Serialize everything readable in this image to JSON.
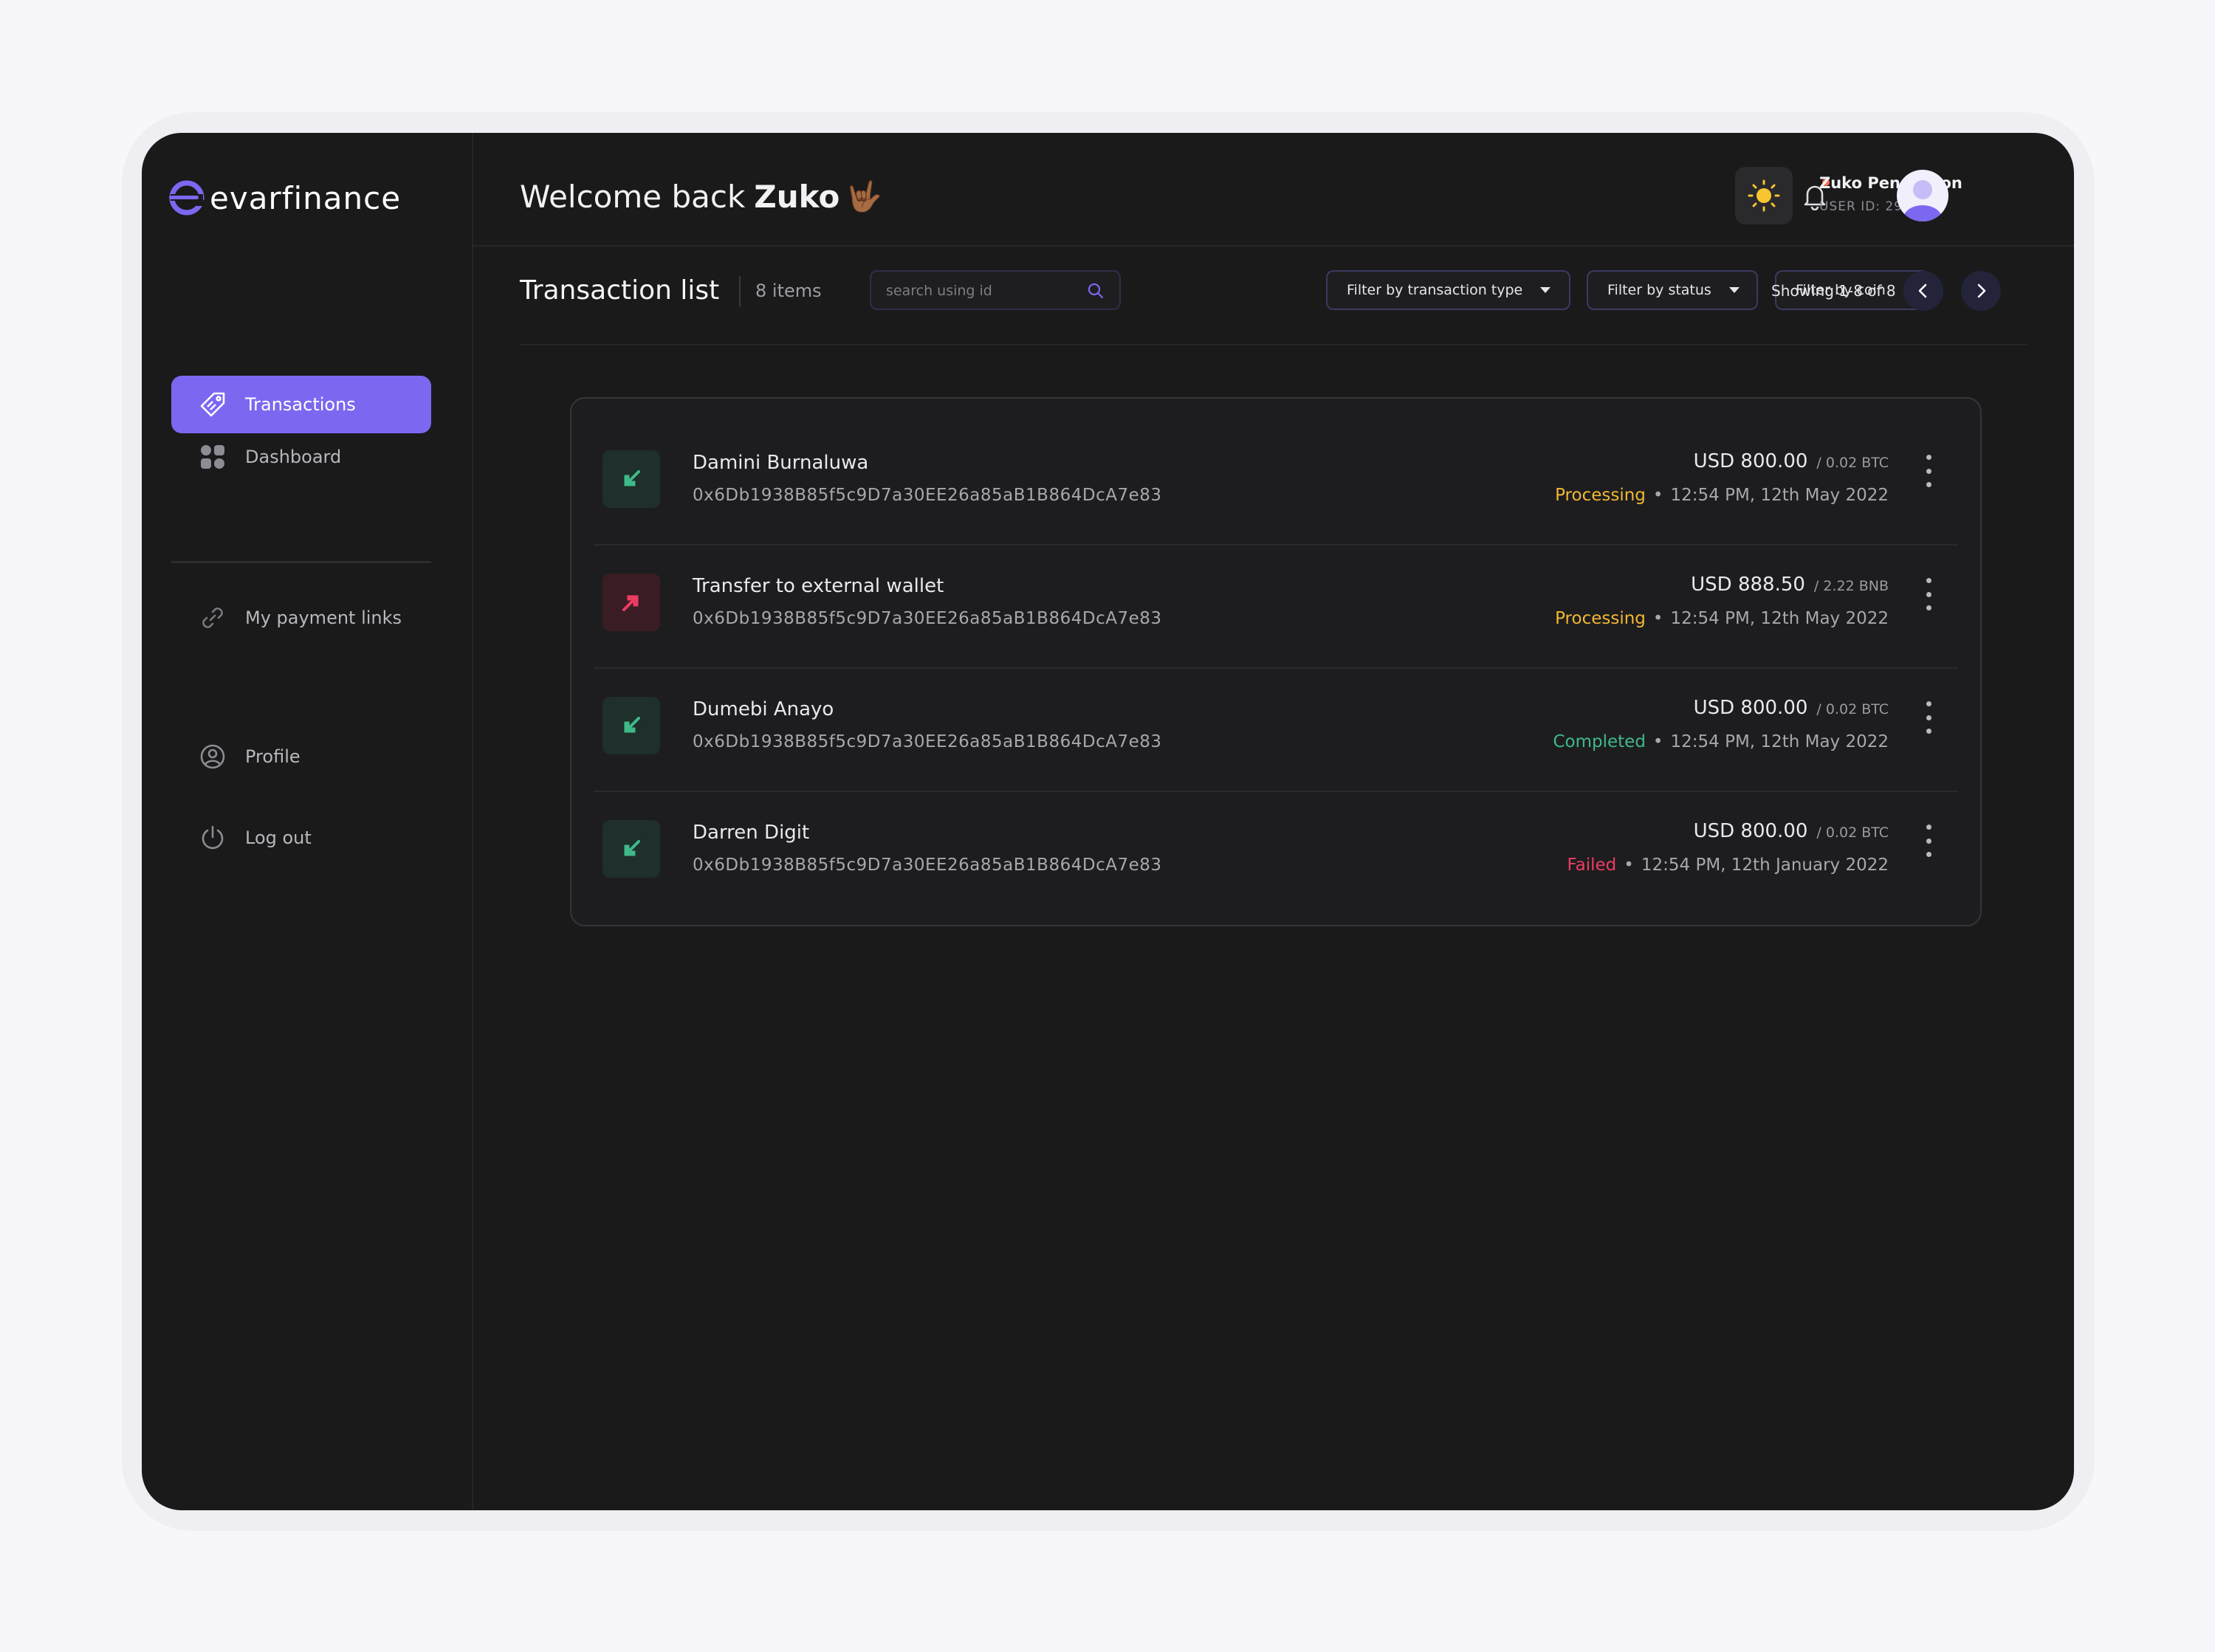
{
  "brand": {
    "name": "evarfinance",
    "accent_color": "#7b68f0"
  },
  "sidebar": {
    "items": [
      {
        "label": "Dashboard",
        "icon": "grid-icon"
      },
      {
        "label": "Transactions",
        "icon": "tag-icon",
        "active": true
      },
      {
        "label": "My payment links",
        "icon": "link-icon"
      },
      {
        "label": "Profile",
        "icon": "user-circle-icon"
      },
      {
        "label": "Log out",
        "icon": "power-icon"
      }
    ]
  },
  "header": {
    "welcome": "Welcome back",
    "first_name": "Zuko",
    "emoji": "🤟🏾",
    "user": {
      "name": "Zuko Pendragon",
      "id_label": "USER ID: 29930"
    }
  },
  "toolbar": {
    "title": "Transaction list",
    "count": "8 items",
    "search_placeholder": "search using id",
    "filters": [
      "Filter by transaction type",
      "Filter by status",
      "Filter by coin"
    ],
    "showing": "Showing 1-8 of 8"
  },
  "transactions": [
    {
      "name": "Damini Burnaluwa",
      "hash": "0x6Db1938B85f5c9D7a30EE26a85aB1B864DcA7e83",
      "usd": "USD 800.00",
      "crypto": "/ 0.02 BTC",
      "status": "Processing",
      "status_color": "#f2b733",
      "datetime": "12:54 PM, 12th May 2022",
      "direction": "incoming"
    },
    {
      "name": "Transfer to external wallet",
      "hash": "0x6Db1938B85f5c9D7a30EE26a85aB1B864DcA7e83",
      "usd": "USD 888.50",
      "crypto": "/ 2.22 BNB",
      "status": "Processing",
      "status_color": "#f2b733",
      "datetime": "12:54 PM, 12th May 2022",
      "direction": "outgoing"
    },
    {
      "name": "Dumebi Anayo",
      "hash": "0x6Db1938B85f5c9D7a30EE26a85aB1B864DcA7e83",
      "usd": "USD 800.00",
      "crypto": "/ 0.02 BTC",
      "status": "Completed",
      "status_color": "#3fb98a",
      "datetime": "12:54 PM, 12th May 2022",
      "direction": "incoming"
    },
    {
      "name": "Darren Digit",
      "hash": "0x6Db1938B85f5c9D7a30EE26a85aB1B864DcA7e83",
      "usd": "USD 800.00",
      "crypto": "/ 0.02 BTC",
      "status": "Failed",
      "status_color": "#ee3b62",
      "datetime": "12:54 PM, 12th January 2022",
      "direction": "incoming"
    }
  ]
}
